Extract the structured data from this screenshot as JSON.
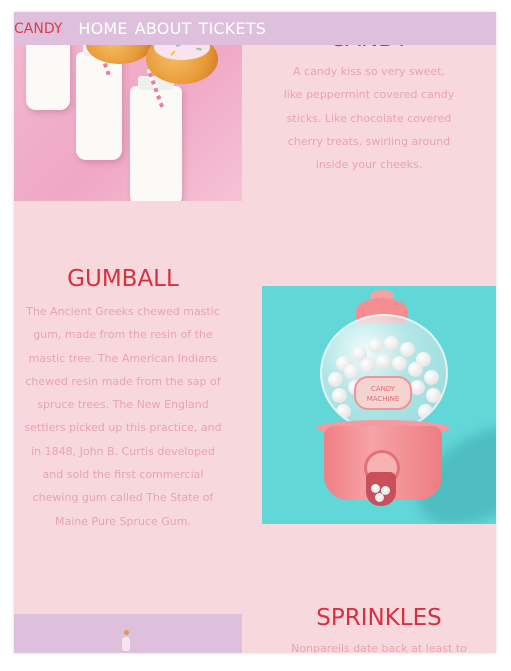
{
  "nav": {
    "brand": "CANDY",
    "links": [
      "HOME",
      "ABOUT",
      "TICKETS"
    ]
  },
  "sections": {
    "candy": {
      "title": "CANDY",
      "paragraph": "A candy kiss so very sweet, like peppermint covered candy sticks. Like chocolate covered cherry treats, swirling around inside your cheeks.",
      "image_icon": "milk-bottles-and-donuts-photo"
    },
    "gumball": {
      "title": "GUMBALL",
      "paragraph": "The Ancient Greeks chewed mastic gum, made from the resin of the mastic tree. The American Indians chewed resin made from the sap of spruce trees. The New England settlers picked up this practice, and in 1848, John B. Curtis developed and sold the first commercial chewing gum called The State of Maine Pure Spruce Gum.",
      "image_icon": "gumball-machine-photo",
      "machine_label": "CANDY MACHINE"
    },
    "sprinkles": {
      "title": "SPRINKLES",
      "paragraph": "Nonpareils date back at least to the",
      "image_icon": "sprinkles-photo"
    }
  },
  "colors": {
    "page_bg": "#f7d9dd",
    "nav_bg": "#dec0dd",
    "title": "#d5313e",
    "text": "#eaa3ad",
    "brand": "#dd3a4a"
  }
}
